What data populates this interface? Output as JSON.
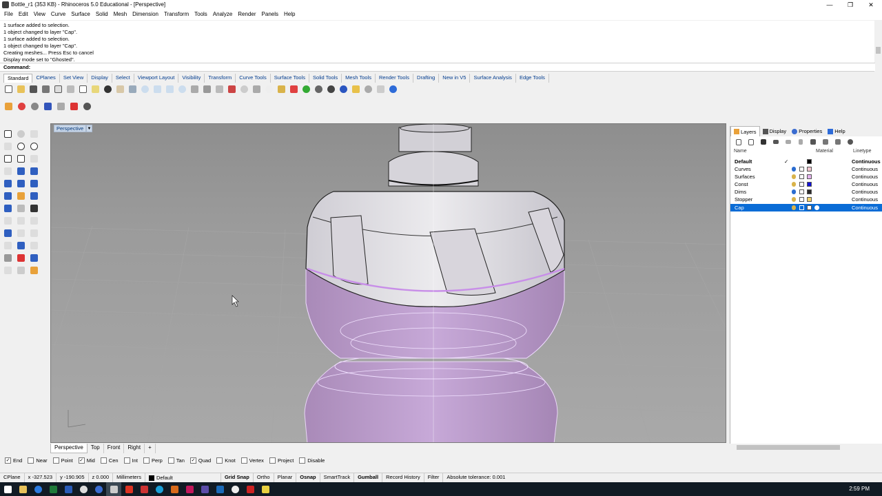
{
  "window": {
    "title": "Bottle_r1 (353 KB) - Rhinoceros 5.0 Educational - [Perspective]",
    "minimize": "—",
    "restore": "❐",
    "close": "✕"
  },
  "menu": [
    "File",
    "Edit",
    "View",
    "Curve",
    "Surface",
    "Solid",
    "Mesh",
    "Dimension",
    "Transform",
    "Tools",
    "Analyze",
    "Render",
    "Panels",
    "Help"
  ],
  "command_history": [
    "1 surface added to selection.",
    "1 object changed to layer \"Cap\".",
    "1 surface added to selection.",
    "1 object changed to layer \"Cap\".",
    "Creating meshes... Press Esc to cancel",
    "Display mode set to \"Ghosted\"."
  ],
  "command_prompt": {
    "label": "Command:",
    "value": ""
  },
  "toolbar_tabs": [
    "Standard",
    "CPlanes",
    "Set View",
    "Display",
    "Select",
    "Viewport Layout",
    "Visibility",
    "Transform",
    "Curve Tools",
    "Surface Tools",
    "Solid Tools",
    "Mesh Tools",
    "Render Tools",
    "Drafting",
    "New in V5",
    "Surface Analysis",
    "Edge Tools"
  ],
  "active_toolbar_tab": "Standard",
  "viewport": {
    "label": "Perspective",
    "dropdown": "▼"
  },
  "view_tabs": [
    "Perspective",
    "Top",
    "Front",
    "Right",
    "+"
  ],
  "osnaps": [
    {
      "label": "End",
      "checked": true
    },
    {
      "label": "Near",
      "checked": false
    },
    {
      "label": "Point",
      "checked": false
    },
    {
      "label": "Mid",
      "checked": true
    },
    {
      "label": "Cen",
      "checked": false
    },
    {
      "label": "Int",
      "checked": false
    },
    {
      "label": "Perp",
      "checked": false
    },
    {
      "label": "Tan",
      "checked": false
    },
    {
      "label": "Quad",
      "checked": true
    },
    {
      "label": "Knot",
      "checked": false
    },
    {
      "label": "Vertex",
      "checked": false
    },
    {
      "label": "Project",
      "checked": false
    },
    {
      "label": "Disable",
      "checked": false
    }
  ],
  "status": {
    "cplane": "CPlane",
    "x": "x -327.523",
    "y": "y -190.905",
    "z": "z 0.000",
    "units": "Millimeters",
    "layer": "Default",
    "grid_snap": "Grid Snap",
    "ortho": "Ortho",
    "planar": "Planar",
    "osnap": "Osnap",
    "smarttrack": "SmartTrack",
    "gumball": "Gumball",
    "record_history": "Record History",
    "filter": "Filter",
    "tolerance": "Absolute tolerance: 0.001"
  },
  "panel_tabs": [
    {
      "label": "Layers",
      "icon": "layers-icon"
    },
    {
      "label": "Display",
      "icon": "display-icon"
    },
    {
      "label": "Properties",
      "icon": "properties-icon"
    },
    {
      "label": "Help",
      "icon": "help-icon"
    }
  ],
  "layer_headers": {
    "name": "Name",
    "material": "Material",
    "linetype": "Linetype"
  },
  "layers": [
    {
      "name": "Default",
      "current": "✓",
      "color": "#000000",
      "linetype": "Continuous",
      "bold": true
    },
    {
      "name": "Curves",
      "current": "",
      "color": "#f2c6cf",
      "linetype": "Continuous"
    },
    {
      "name": "Surfaces",
      "current": "",
      "color": "#e6b3ef",
      "linetype": "Continuous"
    },
    {
      "name": "Const",
      "current": "",
      "color": "#1010d8",
      "linetype": "Continuous"
    },
    {
      "name": "Dims",
      "current": "",
      "color": "#2a2a2a",
      "linetype": "Continuous"
    },
    {
      "name": "Stopper",
      "current": "",
      "color": "#f0d26a",
      "linetype": "Continuous"
    },
    {
      "name": "Cap",
      "current": "",
      "color": "#ffffff",
      "linetype": "Continuous",
      "selected": true
    }
  ],
  "clock": "2:59 PM"
}
